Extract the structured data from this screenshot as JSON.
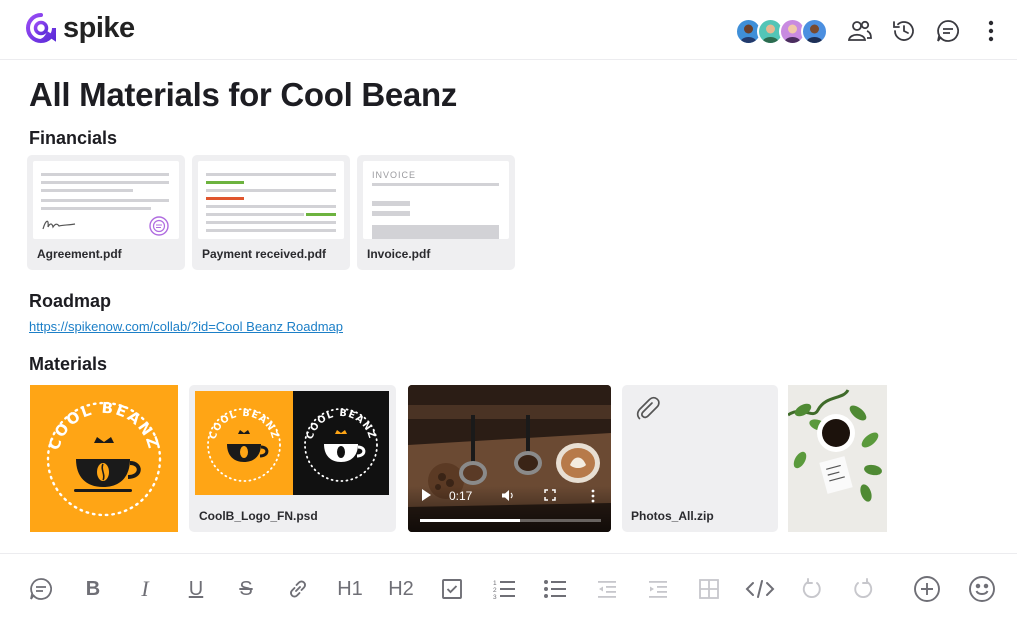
{
  "app": {
    "brand": "spike",
    "brand_color": "#7a3df0"
  },
  "header": {
    "avatars": [
      "member-1",
      "member-2",
      "member-3",
      "member-4"
    ],
    "actions": [
      "people-icon",
      "history-icon",
      "comments-icon",
      "more-vertical-icon"
    ]
  },
  "page": {
    "title": "All Materials for Cool Beanz"
  },
  "financials": {
    "heading": "Financials",
    "files": [
      {
        "name": "Agreement.pdf"
      },
      {
        "name": "Payment received.pdf"
      },
      {
        "name": "Invoice.pdf",
        "thumb_label": "INVOICE"
      }
    ]
  },
  "roadmap": {
    "heading": "Roadmap",
    "link": "https://spikenow.com/collab/?id=Cool Beanz Roadmap"
  },
  "materials": {
    "heading": "Materials",
    "logo_text": "COOL BEANZ",
    "psd_name": "CoolB_Logo_FN.psd",
    "video_time": "0:17",
    "video_progress": 0.55,
    "zip_name": "Photos_All.zip"
  },
  "toolbar": {
    "h1": "H1",
    "h2": "H2",
    "bold": "B",
    "italic": "I",
    "underline": "U",
    "strike": "S",
    "items": [
      "comment-icon",
      "bold-icon",
      "italic-icon",
      "underline-icon",
      "strikethrough-icon",
      "link-icon",
      "heading1-icon",
      "heading2-icon",
      "checkbox-icon",
      "numbered-list-icon",
      "bullet-list-icon",
      "outdent-icon",
      "indent-icon",
      "table-icon",
      "code-icon",
      "undo-icon",
      "redo-icon",
      "add-icon",
      "emoji-icon"
    ]
  },
  "colors": {
    "accent": "#7a3df0",
    "orange": "#ffa515",
    "link": "#1c7fc7",
    "green": "#6db33f",
    "red": "#e0562e"
  }
}
